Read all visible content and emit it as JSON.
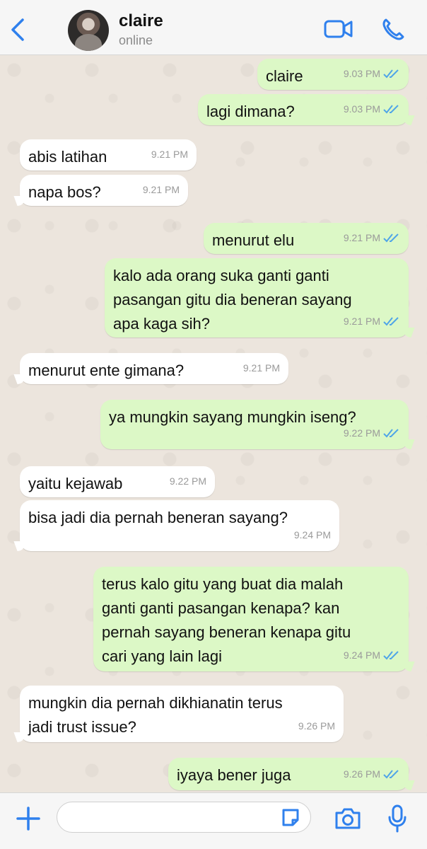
{
  "header": {
    "contact_name": "claire",
    "status": "online",
    "icons": {
      "back": "chevron-left-icon",
      "video": "video-call-icon",
      "call": "phone-icon"
    },
    "accent_color": "#2f80ed"
  },
  "messages": [
    {
      "side": "out",
      "lines": [
        "claire"
      ],
      "time": "9.03 PM",
      "read": true
    },
    {
      "side": "out",
      "lines": [
        "lagi dimana?"
      ],
      "time": "9.03 PM",
      "read": true
    },
    {
      "side": "in",
      "lines": [
        "abis latihan"
      ],
      "time": "9.21 PM"
    },
    {
      "side": "in",
      "lines": [
        "napa bos?"
      ],
      "time": "9.21 PM"
    },
    {
      "side": "out",
      "lines": [
        "menurut elu"
      ],
      "time": "9.21 PM",
      "read": true
    },
    {
      "side": "out",
      "lines": [
        "kalo ada orang suka ganti ganti",
        "pasangan gitu dia beneran sayang",
        "apa kaga sih?"
      ],
      "time": "9.21 PM",
      "read": true
    },
    {
      "side": "in",
      "lines": [
        "menurut ente gimana?"
      ],
      "time": "9.21 PM"
    },
    {
      "side": "out",
      "lines": [
        "ya mungkin sayang mungkin iseng?"
      ],
      "time": "9.22 PM",
      "read": true
    },
    {
      "side": "in",
      "lines": [
        "yaitu kejawab"
      ],
      "time": "9.22 PM"
    },
    {
      "side": "in",
      "lines": [
        "bisa jadi dia pernah beneran sayang?"
      ],
      "time": "9.24 PM"
    },
    {
      "side": "out",
      "lines": [
        "terus kalo gitu yang buat dia malah",
        "ganti ganti pasangan kenapa? kan",
        "pernah sayang beneran kenapa gitu",
        "cari yang lain lagi"
      ],
      "time": "9.24 PM",
      "read": true
    },
    {
      "side": "in",
      "lines": [
        "mungkin dia pernah dikhianatin terus",
        "jadi trust issue?"
      ],
      "time": "9.26 PM"
    },
    {
      "side": "out",
      "lines": [
        "iyaya bener juga"
      ],
      "time": "9.26 PM",
      "read": true
    }
  ],
  "composer": {
    "value": "",
    "icons": {
      "attach": "plus-icon",
      "sticker": "sticker-icon",
      "camera": "camera-icon",
      "mic": "microphone-icon"
    }
  }
}
